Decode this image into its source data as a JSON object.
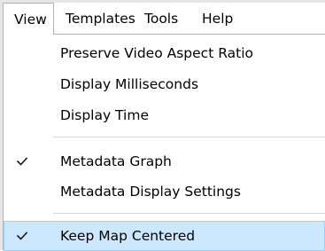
{
  "menubar": {
    "items": [
      {
        "label": "View"
      },
      {
        "label": "Templates"
      },
      {
        "label": "Tools"
      },
      {
        "label": "Help"
      }
    ]
  },
  "view_menu": {
    "items": [
      {
        "label": "Preserve Video Aspect Ratio",
        "checked": false
      },
      {
        "label": "Display Milliseconds",
        "checked": false
      },
      {
        "label": "Display Time",
        "checked": false
      },
      {
        "label": "Metadata Graph",
        "checked": true
      },
      {
        "label": "Metadata Display Settings",
        "checked": false
      },
      {
        "label": "Keep Map Centered",
        "checked": true,
        "highlighted": true
      }
    ]
  },
  "colors": {
    "highlight_fill": "#cce8ff",
    "highlight_border": "#99d1ff",
    "border": "#b3b3b3",
    "separator": "#d7d7d7"
  },
  "icons": {
    "checkmark": "check-icon"
  }
}
